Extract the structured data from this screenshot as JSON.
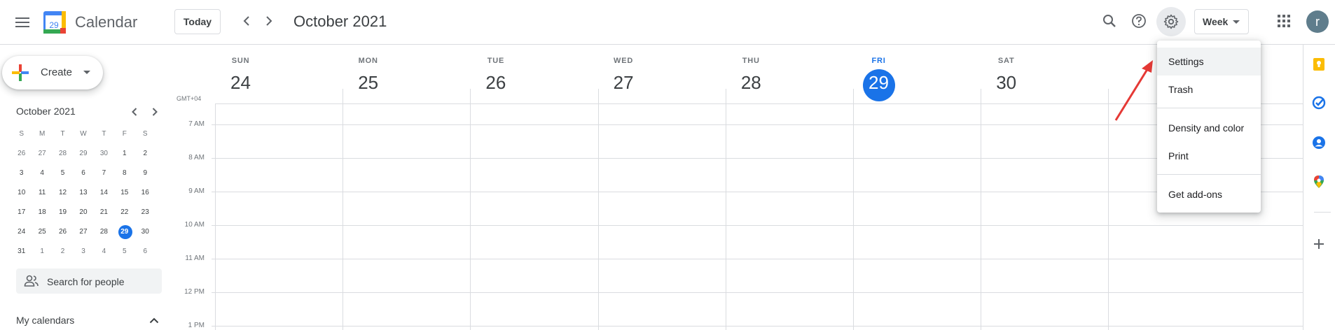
{
  "header": {
    "app_title": "Calendar",
    "logo_day": "29",
    "today_label": "Today",
    "period_title": "October 2021",
    "view_label": "Week",
    "avatar_initial": "r"
  },
  "sidebar": {
    "create_label": "Create",
    "mini_calendar": {
      "title": "October 2021",
      "weekdays": [
        "S",
        "M",
        "T",
        "W",
        "T",
        "F",
        "S"
      ],
      "weeks": [
        [
          [
            "26",
            true
          ],
          [
            "27",
            true
          ],
          [
            "28",
            true
          ],
          [
            "29",
            true
          ],
          [
            "30",
            true
          ],
          [
            "1",
            false
          ],
          [
            "2",
            false
          ]
        ],
        [
          [
            "3",
            false
          ],
          [
            "4",
            false
          ],
          [
            "5",
            false
          ],
          [
            "6",
            false
          ],
          [
            "7",
            false
          ],
          [
            "8",
            false
          ],
          [
            "9",
            false
          ]
        ],
        [
          [
            "10",
            false
          ],
          [
            "11",
            false
          ],
          [
            "12",
            false
          ],
          [
            "13",
            false
          ],
          [
            "14",
            false
          ],
          [
            "15",
            false
          ],
          [
            "16",
            false
          ]
        ],
        [
          [
            "17",
            false
          ],
          [
            "18",
            false
          ],
          [
            "19",
            false
          ],
          [
            "20",
            false
          ],
          [
            "21",
            false
          ],
          [
            "22",
            false
          ],
          [
            "23",
            false
          ]
        ],
        [
          [
            "24",
            false
          ],
          [
            "25",
            false
          ],
          [
            "26",
            false
          ],
          [
            "27",
            false
          ],
          [
            "28",
            false
          ],
          [
            "29",
            false
          ],
          [
            "30",
            false
          ]
        ],
        [
          [
            "31",
            false
          ],
          [
            "1",
            true
          ],
          [
            "2",
            true
          ],
          [
            "3",
            true
          ],
          [
            "4",
            true
          ],
          [
            "5",
            true
          ],
          [
            "6",
            true
          ]
        ]
      ],
      "selected": "29"
    },
    "search_people_placeholder": "Search for people",
    "my_calendars_label": "My calendars"
  },
  "week": {
    "timezone": "GMT+04",
    "days": [
      {
        "dow": "SUN",
        "date": "24"
      },
      {
        "dow": "MON",
        "date": "25"
      },
      {
        "dow": "TUE",
        "date": "26"
      },
      {
        "dow": "WED",
        "date": "27"
      },
      {
        "dow": "THU",
        "date": "28"
      },
      {
        "dow": "FRI",
        "date": "29",
        "today": true
      },
      {
        "dow": "SAT",
        "date": "30"
      }
    ],
    "times": [
      "7 AM",
      "8 AM",
      "9 AM",
      "10 AM",
      "11 AM",
      "12 PM",
      "1 PM"
    ]
  },
  "settings_menu": {
    "items": [
      "Settings",
      "Trash",
      "Density and color",
      "Print",
      "Get add-ons"
    ],
    "highlighted": "Settings"
  },
  "colors": {
    "accent": "#1a73e8",
    "annotation_arrow": "#e53935"
  }
}
